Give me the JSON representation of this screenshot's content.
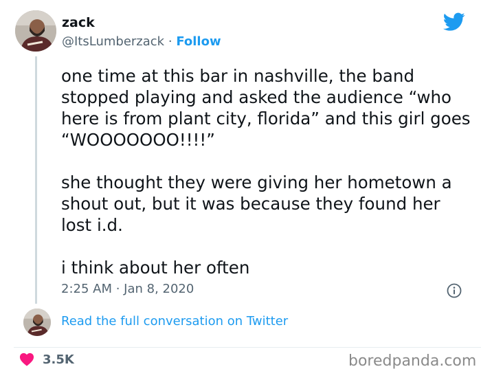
{
  "tweet": {
    "user": {
      "name": "zack",
      "handle": "@ItsLumberzack",
      "separator": "·",
      "follow_label": "Follow",
      "avatar_icon": "person-avatar"
    },
    "text": "one time at this bar in nashville, the band stopped playing and asked the audience “who here is from plant city, florida” and this girl goes “WOOOOOOO!!!!”\n\nshe thought they were giving her hometown a shout out, but it was because they found her lost i.d.\n\ni think about her often",
    "timestamp": "2:25 AM · Jan 8, 2020",
    "read_full_label": "Read the full conversation on Twitter",
    "likes": "3.5K",
    "icons": {
      "brand": "twitter-bird-icon",
      "info": "info-icon",
      "like": "heart-icon"
    }
  },
  "watermark": "boredpanda.com",
  "colors": {
    "accent": "#1d9bf0",
    "text": "#0f1419",
    "muted": "#536471",
    "heart": "#f91880"
  }
}
